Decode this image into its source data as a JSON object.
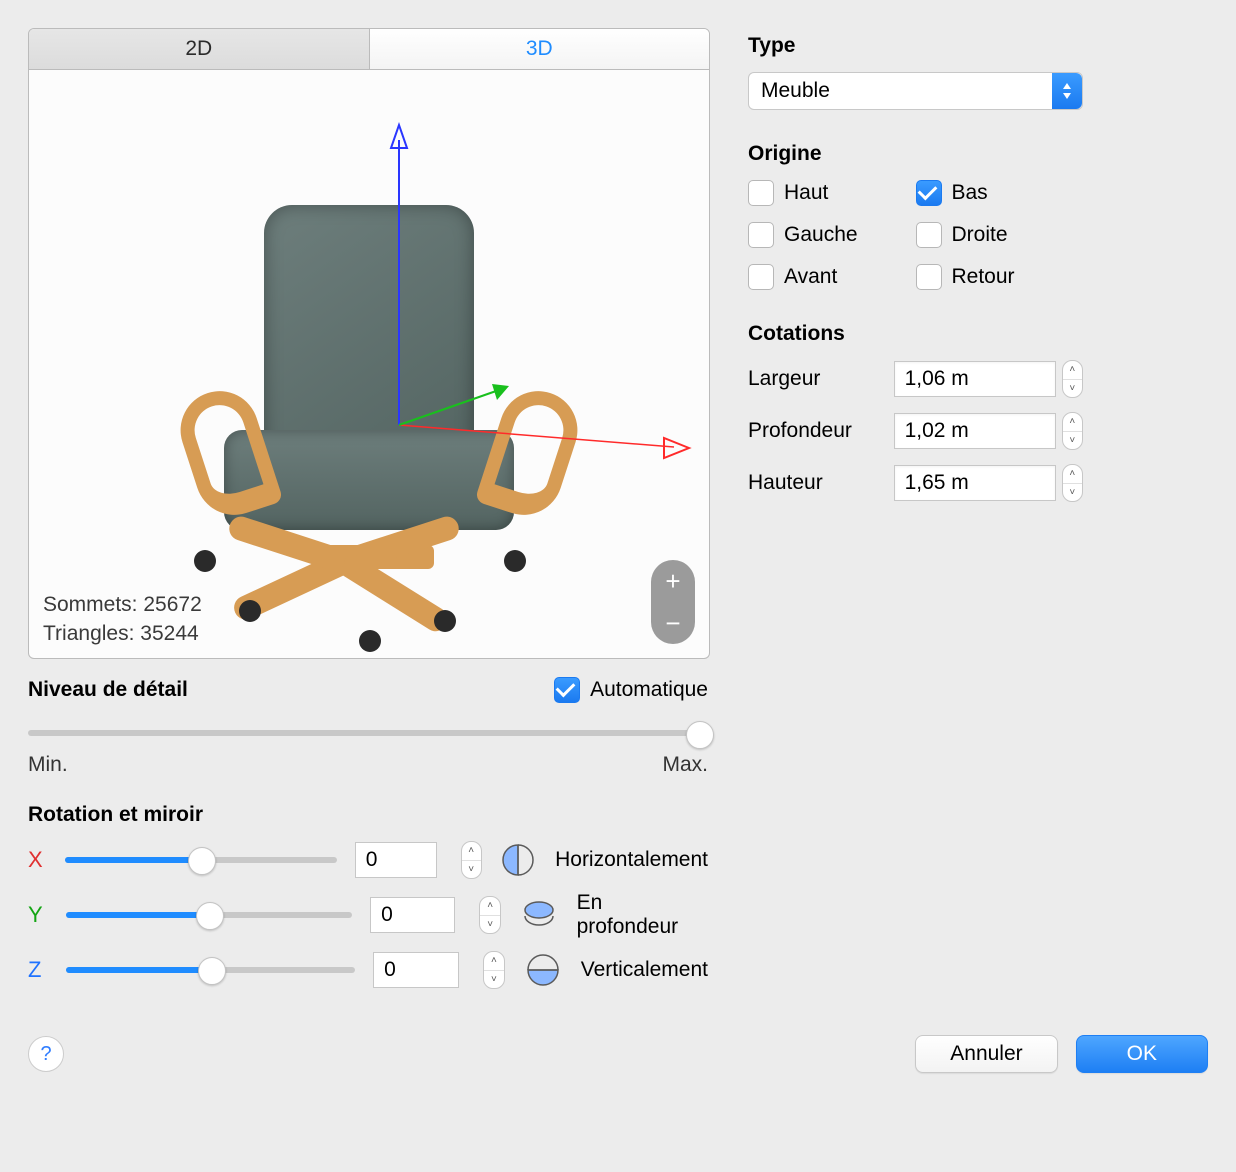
{
  "tabs": {
    "tab2d": "2D",
    "tab3d": "3D"
  },
  "viewport": {
    "stats_vertices_label": "Sommets:",
    "stats_vertices_value": "25672",
    "stats_triangles_label": "Triangles:",
    "stats_triangles_value": "35244"
  },
  "right": {
    "type_title": "Type",
    "type_value": "Meuble",
    "origin_title": "Origine",
    "origin": {
      "haut": "Haut",
      "bas": "Bas",
      "gauche": "Gauche",
      "droite": "Droite",
      "avant": "Avant",
      "retour": "Retour"
    },
    "dimensions_title": "Cotations",
    "dim": {
      "largeur_label": "Largeur",
      "largeur_value": "1,06 m",
      "profondeur_label": "Profondeur",
      "profondeur_value": "1,02 m",
      "hauteur_label": "Hauteur",
      "hauteur_value": "1,65 m"
    }
  },
  "lod": {
    "title": "Niveau de détail",
    "auto_label": "Automatique",
    "min": "Min.",
    "max": "Max."
  },
  "rotation": {
    "title": "Rotation et miroir",
    "x_label": "X",
    "y_label": "Y",
    "z_label": "Z",
    "x_value": "0",
    "y_value": "0",
    "z_value": "0",
    "mirror_h": "Horizontalement",
    "mirror_d": "En profondeur",
    "mirror_v": "Verticalement"
  },
  "footer": {
    "help": "?",
    "cancel": "Annuler",
    "ok": "OK"
  }
}
